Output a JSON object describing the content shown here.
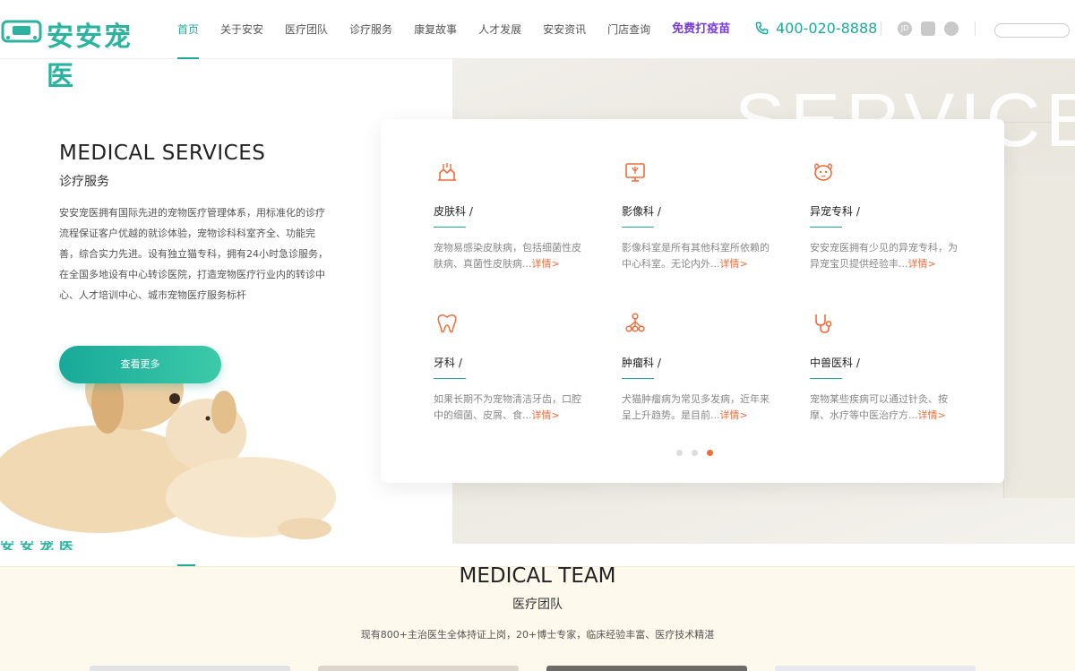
{
  "header": {
    "logo_text": "安安宠医",
    "nav": [
      "首页",
      "关于安安",
      "医疗团队",
      "诊疗服务",
      "康复故事",
      "人才发展",
      "安安资讯",
      "门店查询",
      "免费打疫苗"
    ],
    "phone": "400-020-8888",
    "social": [
      {
        "icon": "jd-icon",
        "label": "JD"
      },
      {
        "icon": "tmall-icon",
        "label": ""
      },
      {
        "icon": "wechat-icon",
        "label": ""
      }
    ]
  },
  "hero": {
    "title": "MEDICAL SERVICES",
    "subtitle": "诊疗服务",
    "description": "安安宠医拥有国际先进的宠物医疗管理体系，用标准化的诊疗流程保证客户优越的就诊体验，宠物诊科科室齐全、功能完善，综合实力先进。设有独立猫专科，拥有24小时急诊服务，在全国多地设有中心转诊医院，打造宠物医疗行业内的转诊中心、人才培训中心、城市宠物医疗服务标杆",
    "button": "查看更多",
    "bg_watermark": "SERVICES"
  },
  "services": [
    {
      "icon": "skin-icon",
      "name": "皮肤科",
      "desc": "宠物易感染皮肤病，包括细菌性皮肤病、真菌性皮肤病...",
      "more": "详情>"
    },
    {
      "icon": "imaging-icon",
      "name": "影像科",
      "desc": "影像科室是所有其他科室所依赖的中心科室。无论内外...",
      "more": "详情>"
    },
    {
      "icon": "exotic-pet-icon",
      "name": "异宠专科",
      "desc": "安安宠医拥有少见的异宠专科，为异宠宝贝提供经验丰...",
      "more": "详情>"
    },
    {
      "icon": "tooth-icon",
      "name": "牙科",
      "desc": "如果长期不为宠物清洁牙齿，口腔中的细菌、皮屑、食...",
      "more": "详情>"
    },
    {
      "icon": "tumor-icon",
      "name": "肿瘤科",
      "desc": "犬猫肿瘤病为常见多发病，近年来呈上升趋势。是目前...",
      "more": "详情>"
    },
    {
      "icon": "stethoscope-icon",
      "name": "中兽医科",
      "desc": "宠物某些疾病可以通过针灸、按摩、水疗等中医治疗方...",
      "more": "详情>"
    }
  ],
  "team": {
    "title": "MEDICAL TEAM",
    "subtitle": "医疗团队",
    "description": "现有800+主治医生全体持证上岗，20+博士专家，临床经验丰富、医疗技术精湛"
  },
  "colors": {
    "accent": "#20a99a",
    "highlight": "#7a3cd9",
    "link": "#f26b3a"
  }
}
